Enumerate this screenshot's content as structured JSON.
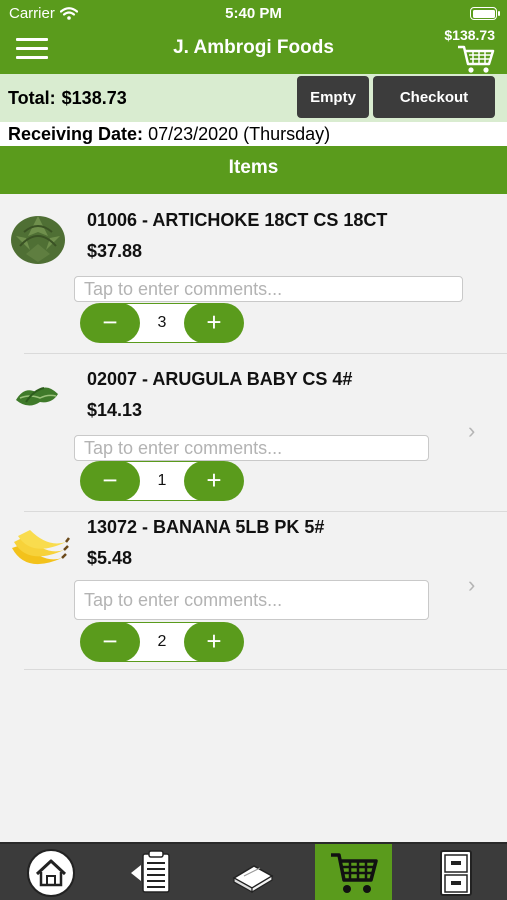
{
  "status_bar": {
    "carrier": "Carrier",
    "time": "5:40 PM"
  },
  "nav": {
    "title": "J. Ambrogi Foods",
    "cart_total": "$138.73"
  },
  "summary": {
    "total_label": "Total:",
    "total_value": "$138.73",
    "empty_label": "Empty",
    "checkout_label": "Checkout",
    "receiving_label": "Receiving Date:",
    "receiving_value": "07/23/2020 (Thursday)"
  },
  "items_header": "Items",
  "items": [
    {
      "title": "01006 - ARTICHOKE 18CT CS 18CT",
      "price": "$37.88",
      "comment_placeholder": "Tap to enter comments...",
      "quantity": "3",
      "image": "artichoke-image"
    },
    {
      "title": "02007 - ARUGULA BABY CS 4#",
      "price": "$14.13",
      "comment_placeholder": "Tap to enter comments...",
      "quantity": "1",
      "image": "arugula-image"
    },
    {
      "title": "13072 - BANANA 5LB PK 5#",
      "price": "$5.48",
      "comment_placeholder": "Tap to enter comments...",
      "quantity": "2",
      "image": "banana-image"
    }
  ],
  "tabs": [
    {
      "icon": "home-icon",
      "active": false
    },
    {
      "icon": "order-list-icon",
      "active": false
    },
    {
      "icon": "catalog-book-icon",
      "active": false
    },
    {
      "icon": "cart-icon",
      "active": true
    },
    {
      "icon": "file-cabinet-icon",
      "active": false
    }
  ],
  "colors": {
    "brand_green": "#5a9b1c",
    "summary_bg": "#d9ecd0",
    "button_dark": "#3c3c3c",
    "tabbar_bg": "#3b3b3b"
  }
}
